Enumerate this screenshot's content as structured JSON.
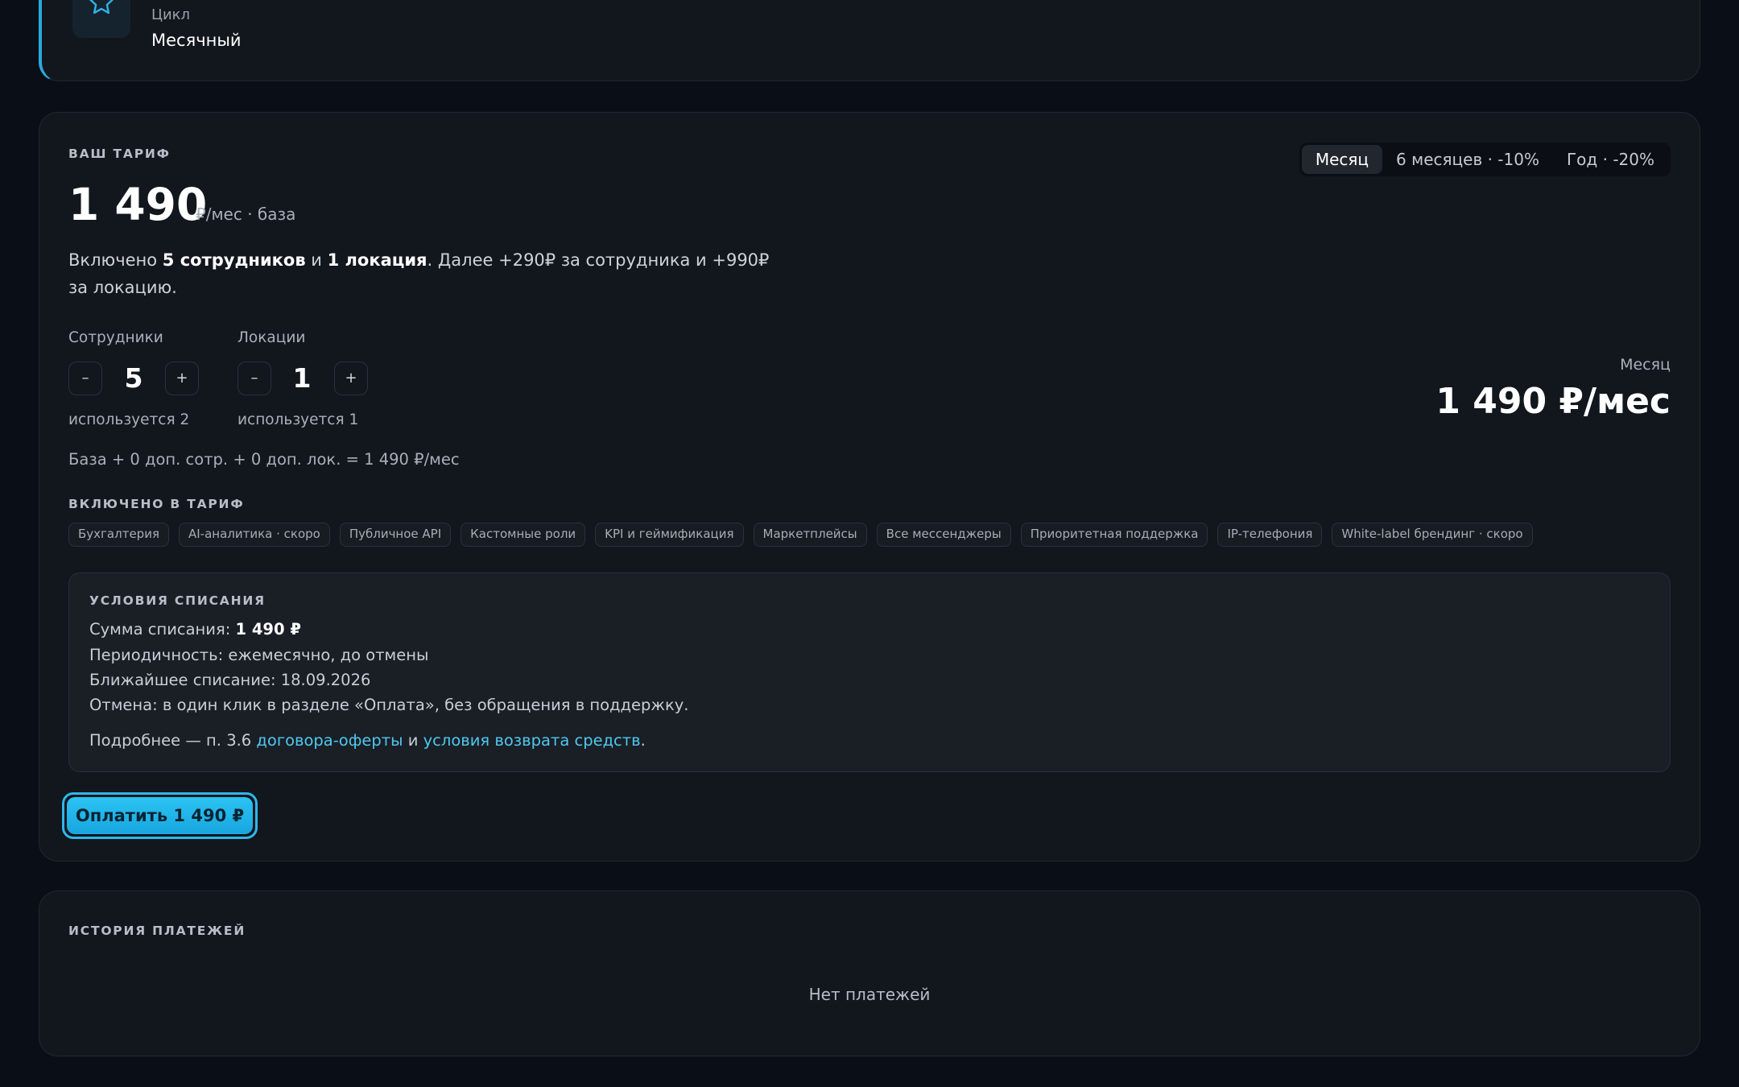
{
  "cycle": {
    "label": "Цикл",
    "value": "Месячный",
    "icon": "star-icon",
    "accent": "#29a9de"
  },
  "tariff": {
    "eyebrow": "ВАШ ТАРИФ",
    "price": "1 490",
    "price_unit": "₽/мес · база",
    "desc_1": "Включено ",
    "desc_employees": "5 сотрудников",
    "desc_2": " и ",
    "desc_locations": "1 локация",
    "desc_3": ". Далее +290₽ за сотрудника и +990₽ за локацию.",
    "period_options": [
      "Месяц",
      "6 месяцев · -10%",
      "Год · -20%"
    ],
    "period_selected": "Месяц",
    "employees": {
      "label": "Сотрудники",
      "value": "5",
      "used": "используется 2",
      "minus": "–",
      "plus": "+"
    },
    "locations": {
      "label": "Локации",
      "value": "1",
      "used": "используется 1",
      "minus": "–",
      "plus": "+"
    },
    "formula": "База + 0 доп. сотр. + 0 доп. лок. = 1 490 ₽/мес",
    "total_label": "Месяц",
    "total_value": "1 490 ₽/мес",
    "included_eyebrow": "ВКЛЮЧЕНО В ТАРИФ",
    "features": [
      "Бухгалтерия",
      "AI-аналитика · скоро",
      "Публичное API",
      "Кастомные роли",
      "KPI и геймификация",
      "Маркетплейсы",
      "Все мессенджеры",
      "Приоритетная поддержка",
      "IP-телефония",
      "White-label брендинг · скоро"
    ],
    "terms": {
      "eyebrow": "УСЛОВИЯ СПИСАНИЯ",
      "amount_label": "Сумма списания: ",
      "amount_value": "1 490 ₽",
      "periodicity": "Периодичность: ежемесячно, до отмены",
      "next_charge": "Ближайшее списание: 18.09.2026",
      "cancel": "Отмена: в один клик в разделе «Оплата», без обращения в поддержку.",
      "more_prefix": "Подробнее — п. 3.6 ",
      "offer_link": "договора-оферты",
      "more_mid": " и ",
      "refund_link": "условия возврата средств",
      "more_suffix": "."
    },
    "pay_button": "Оплатить 1 490 ₽"
  },
  "history": {
    "eyebrow": "ИСТОРИЯ ПЛАТЕЖЕЙ",
    "empty": "Нет платежей"
  }
}
